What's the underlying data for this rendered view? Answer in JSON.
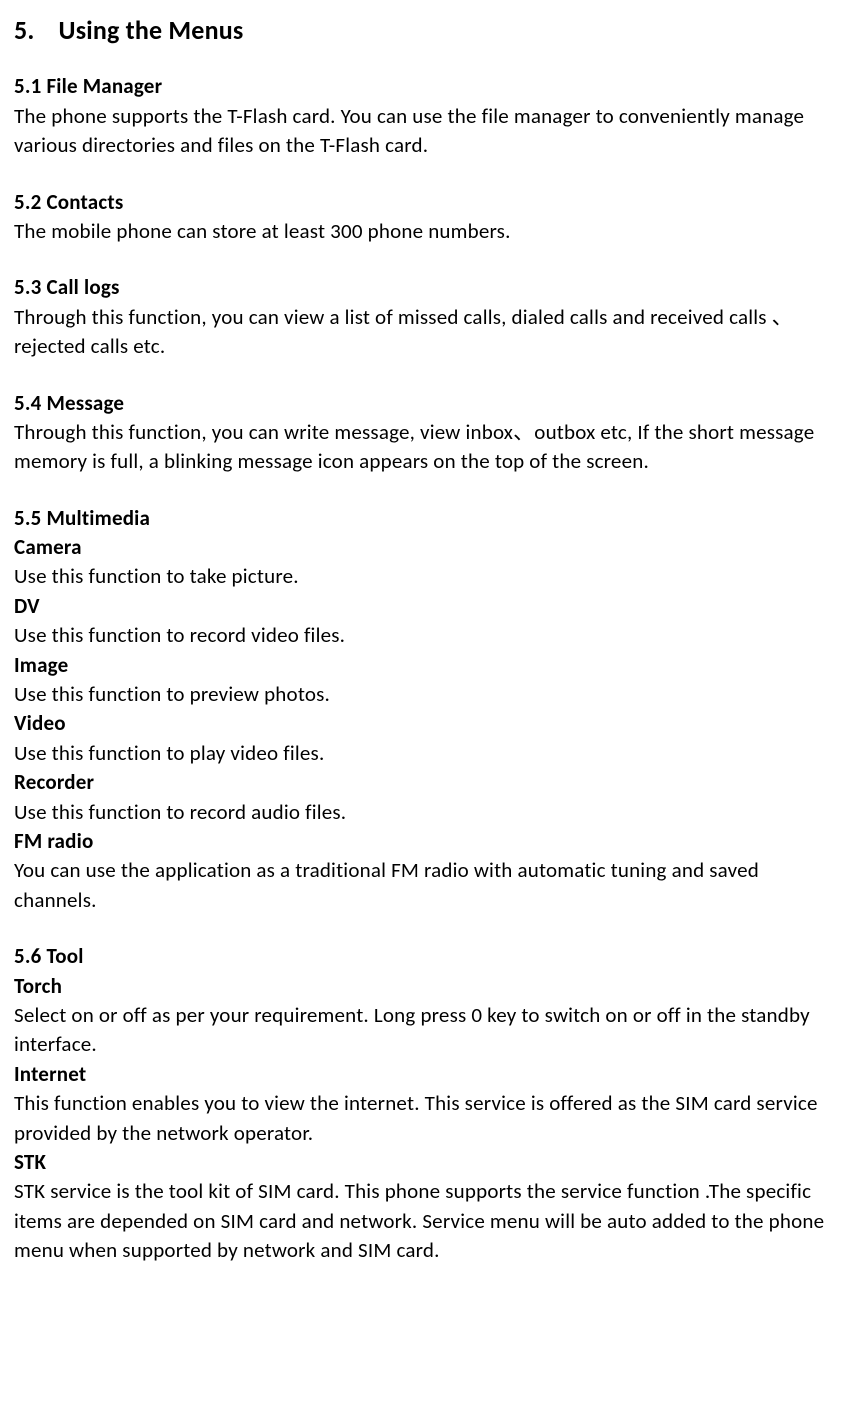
{
  "h1": {
    "num": "5.",
    "title": "Using the Menus"
  },
  "sections": {
    "s1": {
      "heading": "5.1 File Manager",
      "body": "The phone supports the T-Flash card. You can use the file manager to conveniently manage various directories and files on the T-Flash card."
    },
    "s2": {
      "heading": "5.2 Contacts",
      "body": "The mobile phone can store at least 300 phone numbers."
    },
    "s3": {
      "heading": "5.3 Call logs",
      "body": "Through this function, you can view a list of missed calls, dialed calls and received calls 、rejected calls etc."
    },
    "s4": {
      "heading": "5.4 Message",
      "body": "Through this function, you can write message, view inbox、outbox etc, If the short message memory is full, a blinking message icon appears on the top of the screen."
    },
    "s5": {
      "heading": "5.5 Multimedia",
      "camera": {
        "label": "Camera",
        "body": "Use this function to take picture."
      },
      "dv": {
        "label": "DV",
        "body": "Use this function to record video files."
      },
      "image": {
        "label": "Image",
        "body": "Use this function to preview photos."
      },
      "video": {
        "label": "Video",
        "body": "Use this function to play video files."
      },
      "recorder": {
        "label": "Recorder",
        "body": "Use this function to record audio files."
      },
      "fm": {
        "label": "FM radio",
        "body1": "You can use the application as a traditional FM radio with automatic tuning and saved",
        "body2": "channels."
      }
    },
    "s6": {
      "heading": "5.6 Tool",
      "torch": {
        "label": "Torch",
        "body": "Select on or off as per your requirement. Long press 0 key to switch on or off in the standby interface."
      },
      "internet": {
        "label": "Internet",
        "body": "This function enables you to view the internet. This service is offered as the SIM card service provided by the network operator."
      },
      "stk": {
        "label": "STK",
        "body": "STK service is the tool kit of SIM card. This phone supports the service function .The specific items are depended on SIM card and network. Service menu will be auto added to the phone menu when supported by network and SIM card."
      }
    }
  }
}
